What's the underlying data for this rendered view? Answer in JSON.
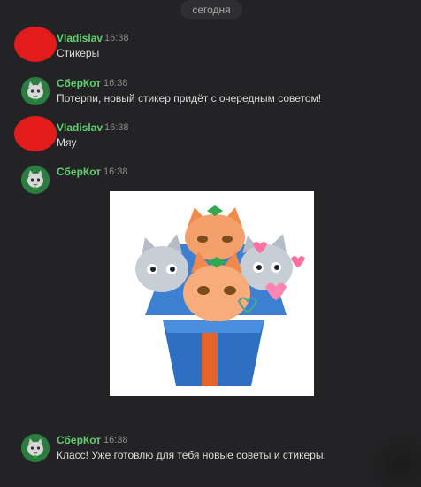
{
  "date_divider": "сегодня",
  "messages": [
    {
      "author": "Vladislav",
      "time": "16:38",
      "text": "Стикеры"
    },
    {
      "author": "СберКот",
      "time": "16:38",
      "text": "Потерпи, новый стикер придёт с очередным советом!"
    },
    {
      "author": "Vladislav",
      "time": "16:38",
      "text": "Мяу"
    },
    {
      "author": "СберКот",
      "time": "16:38",
      "text": ""
    },
    {
      "author": "СберКот",
      "time": "16:38",
      "text": "Класс! Уже готовлю для тебя новые советы и стикеры."
    }
  ],
  "colors": {
    "background": "#232325",
    "author_name": "#5fcf6e",
    "user_avatar": "#e31b1b",
    "bot_avatar": "#2a7d3f"
  },
  "icons": {
    "user_avatar": "red-blob-avatar",
    "bot_avatar": "cat-avatar",
    "sticker": "cats-in-gift-box-sticker"
  }
}
